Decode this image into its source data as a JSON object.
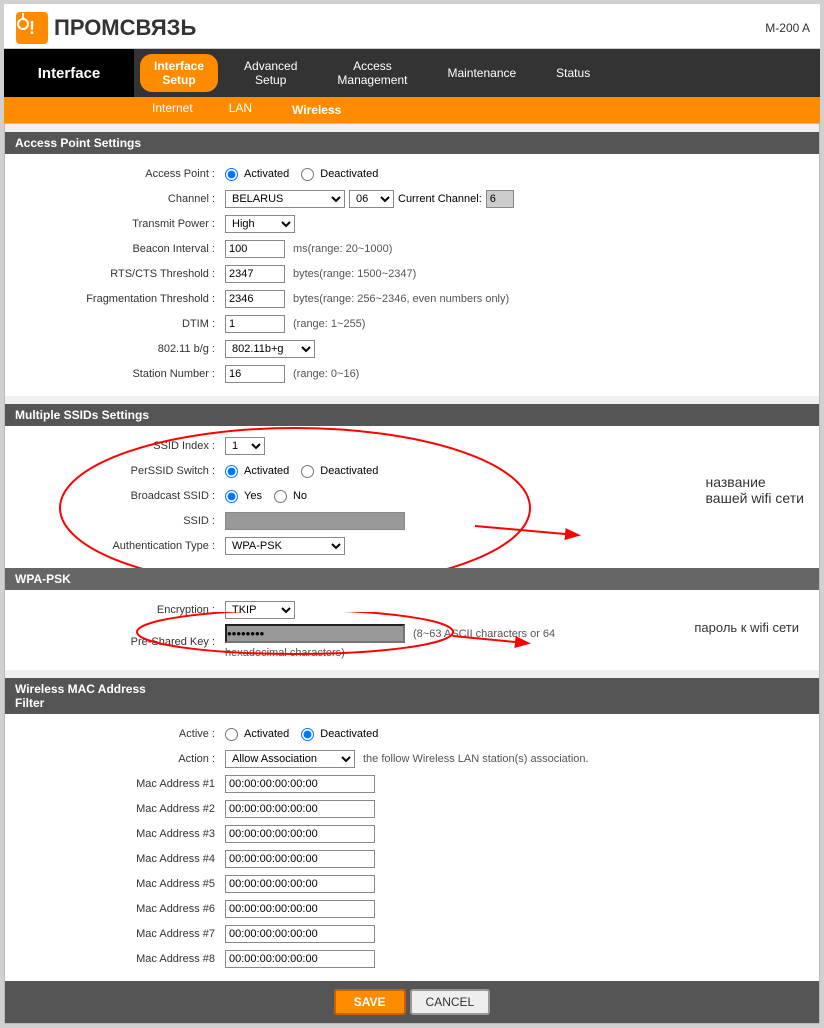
{
  "header": {
    "logo_text": "ПРОМСВЯЗЬ",
    "model": "M-200 A"
  },
  "nav": {
    "interface_label": "Interface",
    "tabs": [
      {
        "label": "Interface\nSetup",
        "id": "interface-setup",
        "active": true
      },
      {
        "label": "Advanced\nSetup",
        "id": "advanced-setup",
        "active": false
      },
      {
        "label": "Access\nManagement",
        "id": "access-management",
        "active": false
      },
      {
        "label": "Maintenance",
        "id": "maintenance",
        "active": false
      },
      {
        "label": "Status",
        "id": "status",
        "active": false
      }
    ],
    "sub_tabs": [
      {
        "label": "Internet",
        "id": "internet",
        "active": false
      },
      {
        "label": "LAN",
        "id": "lan",
        "active": false
      },
      {
        "label": "Wireless",
        "id": "wireless",
        "active": true
      }
    ]
  },
  "access_point_settings": {
    "section_title": "Access Point Settings",
    "fields": {
      "access_point_label": "Access Point :",
      "access_point_activated": "Activated",
      "access_point_deactivated": "Deactivated",
      "channel_label": "Channel :",
      "channel_country": "BELARUS",
      "channel_num": "06",
      "current_channel_label": "Current Channel:",
      "current_channel_val": "6",
      "transmit_power_label": "Transmit Power :",
      "transmit_power_val": "High",
      "beacon_interval_label": "Beacon Interval :",
      "beacon_interval_val": "100",
      "beacon_interval_hint": "ms(range: 20~1000)",
      "rts_label": "RTS/CTS Threshold :",
      "rts_val": "2347",
      "rts_hint": "bytes(range: 1500~2347)",
      "frag_label": "Fragmentation Threshold :",
      "frag_val": "2346",
      "frag_hint": "bytes(range: 256~2346, even numbers only)",
      "dtim_label": "DTIM :",
      "dtim_val": "1",
      "dtim_hint": "(range: 1~255)",
      "dot11_label": "802.11 b/g :",
      "dot11_val": "802.11b+g",
      "station_label": "Station Number :",
      "station_val": "16",
      "station_hint": "(range: 0~16)"
    }
  },
  "multiple_ssids": {
    "section_title": "Multiple SSIDs Settings",
    "fields": {
      "ssid_index_label": "SSID Index :",
      "ssid_index_val": "1",
      "perssid_label": "PerSSID Switch :",
      "perssid_activated": "Activated",
      "perssid_deactivated": "Deactivated",
      "broadcast_label": "Broadcast SSID :",
      "broadcast_yes": "Yes",
      "broadcast_no": "No",
      "ssid_label": "SSID :",
      "auth_label": "Authentication Type :",
      "auth_val": "WPA-PSK"
    }
  },
  "wpa_psk": {
    "section_title": "WPA-PSK",
    "fields": {
      "encryption_label": "Encryption :",
      "encryption_val": "TKIP",
      "pre_shared_label": "Pre-Shared Key :",
      "pre_shared_hint": "(8~63 ASCII characters or 64",
      "pre_shared_hint2": "hexadecimal characters)"
    }
  },
  "mac_filter": {
    "section_title": "Wireless MAC Address\nFilter",
    "fields": {
      "active_label": "Active :",
      "active_activated": "Activated",
      "active_deactivated": "Deactivated",
      "action_label": "Action :",
      "action_val": "Allow Association",
      "action_suffix": "the follow Wireless LAN station(s) association.",
      "mac_addresses": [
        {
          "label": "Mac Address #1",
          "val": "00:00:00:00:00:00"
        },
        {
          "label": "Mac Address #2",
          "val": "00:00:00:00:00:00"
        },
        {
          "label": "Mac Address #3",
          "val": "00:00:00:00:00:00"
        },
        {
          "label": "Mac Address #4",
          "val": "00:00:00:00:00:00"
        },
        {
          "label": "Mac Address #5",
          "val": "00:00:00:00:00:00"
        },
        {
          "label": "Mac Address #6",
          "val": "00:00:00:00:00:00"
        },
        {
          "label": "Mac Address #7",
          "val": "00:00:00:00:00:00"
        },
        {
          "label": "Mac Address #8",
          "val": "00:00:00:00:00:00"
        }
      ]
    }
  },
  "footer": {
    "save_label": "SAVE",
    "cancel_label": "CANCEL"
  },
  "annotations": {
    "ssid_title": "название",
    "ssid_sub": "вашей wifi сети",
    "password_title": "пароль к wifi сети"
  }
}
